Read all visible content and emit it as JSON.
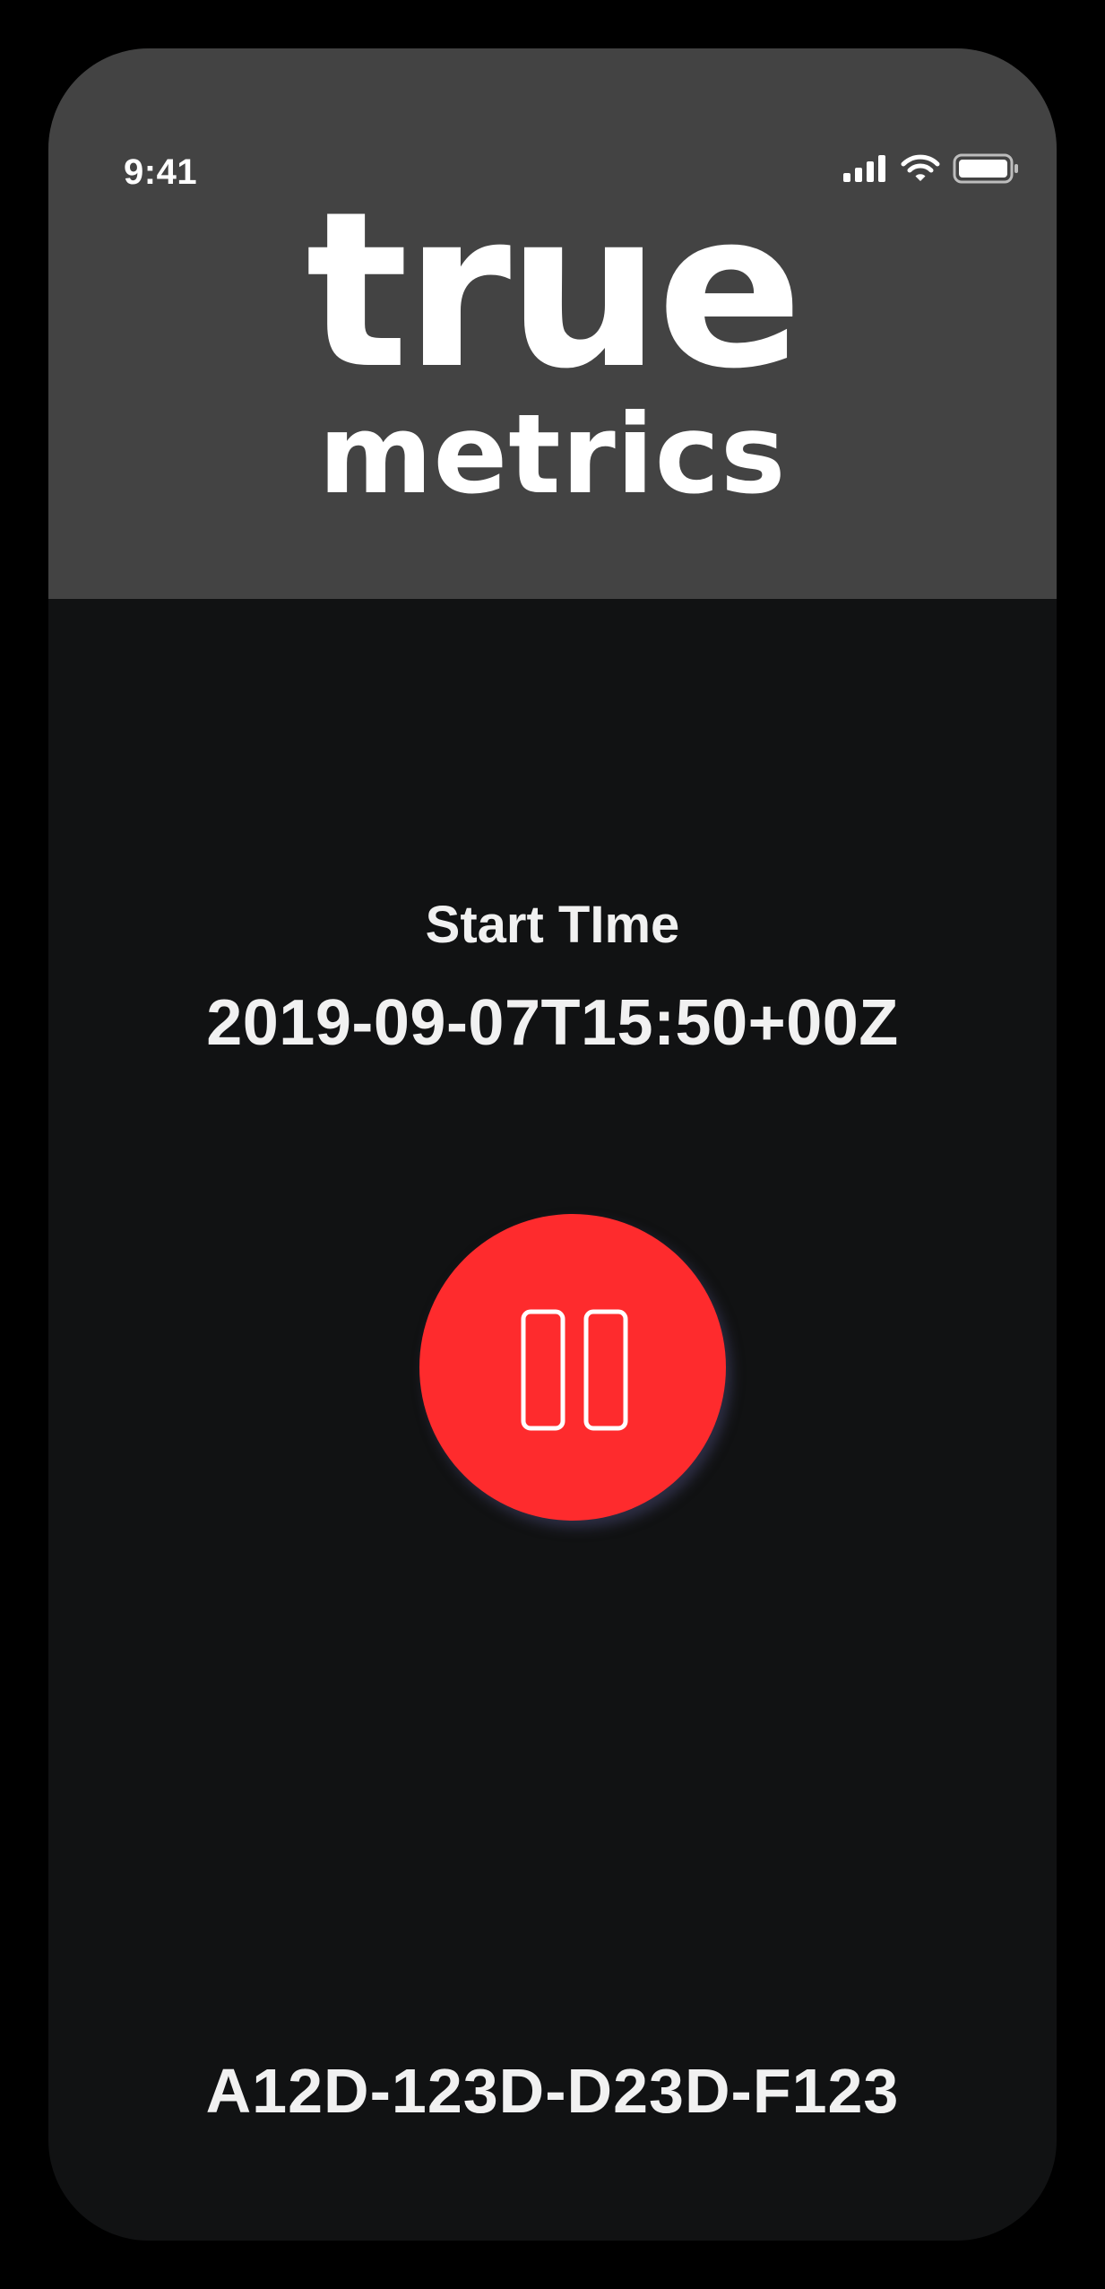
{
  "status_bar": {
    "time": "9:41",
    "icons": [
      "cellular-signal-icon",
      "wifi-icon",
      "battery-icon"
    ]
  },
  "header": {
    "logo_line1": "true",
    "logo_line2": "metrics",
    "background": "#434343"
  },
  "session": {
    "start_label": "Start TIme",
    "start_value": "2019-09-07T15:50+00Z"
  },
  "controls": {
    "pause_button_icon": "pause-icon",
    "accent_color": "#fe2b2d"
  },
  "footer": {
    "device_id": "A12D-123D-D23D-F123"
  }
}
